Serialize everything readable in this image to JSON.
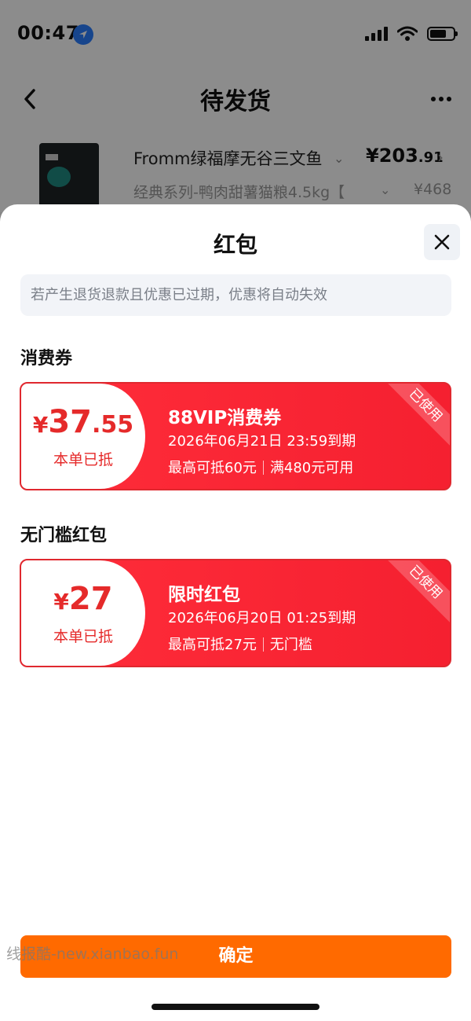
{
  "status_bar": {
    "time": "00:47"
  },
  "nav": {
    "title": "待发货"
  },
  "product": {
    "name": "Fromm绿福摩无谷三文鱼",
    "spec": "经典系列-鸭肉甜薯猫粮4.5kg【",
    "price_main": "¥203",
    "price_decimal": ".91",
    "original_price": "¥468"
  },
  "sheet": {
    "title": "红包",
    "notice": "若产生退货退款且优惠已过期，优惠将自动失效",
    "sections": [
      {
        "title": "消费券",
        "coupon": {
          "currency": "¥",
          "amount_int": "37",
          "amount_dec": ".55",
          "used_label": "本单已抵",
          "name": "88VIP消费券",
          "expiry": "2026年06月21日 23:59到期",
          "limit_left": "最高可抵60元",
          "limit_right": "满480元可用",
          "corner": "已使用"
        }
      },
      {
        "title": "无门槛红包",
        "coupon": {
          "currency": "¥",
          "amount_int": "27",
          "amount_dec": "",
          "used_label": "本单已抵",
          "name": "限时红包",
          "expiry": "2026年06月20日 01:25到期",
          "limit_left": "最高可抵27元",
          "limit_right": "无门槛",
          "corner": "已使用"
        }
      }
    ],
    "confirm_label": "确定",
    "watermark": "线报酷-new.xianbao.fun"
  },
  "colors": {
    "coupon_red": "#ff2d3a",
    "confirm_orange": "#ff6a00",
    "amount_red": "#e52a2a"
  },
  "icons": [
    "location-arrow-icon",
    "signal-icon",
    "wifi-icon",
    "battery-icon",
    "back-chevron-icon",
    "more-icon",
    "chevron-down-icon",
    "chevron-right-icon",
    "close-icon"
  ]
}
